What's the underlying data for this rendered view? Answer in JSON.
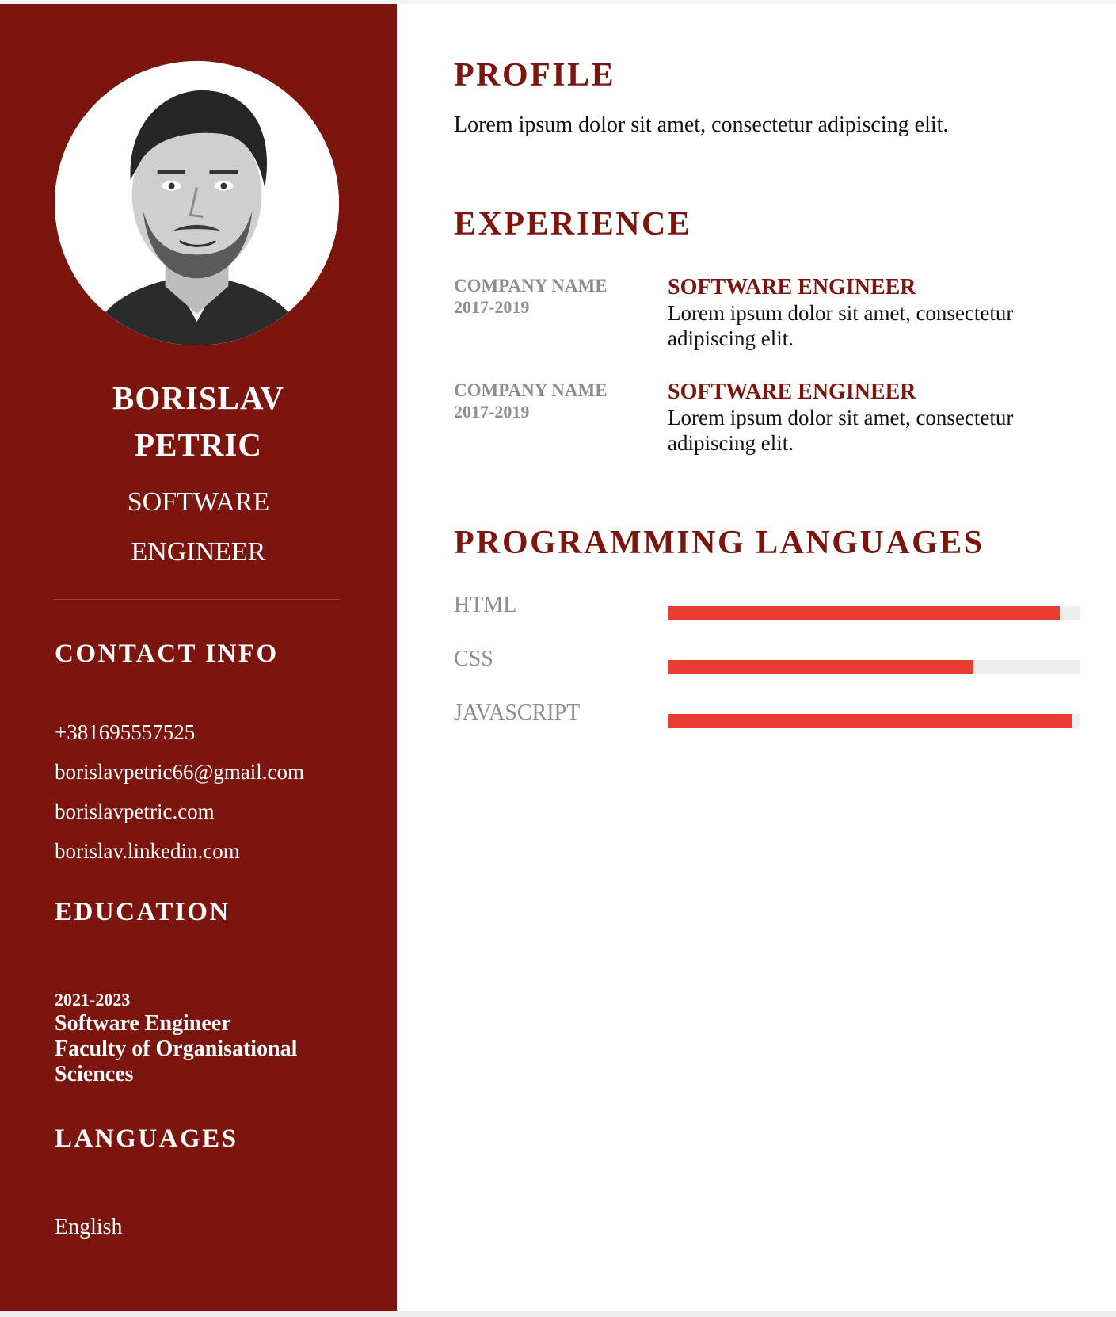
{
  "sidebar": {
    "name": [
      "BORISLAV",
      "PETRIC"
    ],
    "title": [
      "SOFTWARE",
      "ENGINEER"
    ],
    "contact": {
      "heading": "CONTACT INFO",
      "phone": "+381695557525",
      "email": "borislavpetric66@gmail.com",
      "website": "borislavpetric.com",
      "linkedin": "borislav.linkedin.com"
    },
    "education": {
      "heading": "EDUCATION",
      "years": "2021-2023",
      "degree_lines": [
        "Software Engineer",
        "Faculty of Organisational",
        "Sciences"
      ]
    },
    "languages": {
      "heading": "LANGUAGES",
      "items": [
        "English"
      ]
    }
  },
  "main": {
    "profile": {
      "heading": "PROFILE",
      "text": "Lorem ipsum dolor sit amet, consectetur adipiscing elit."
    },
    "experience": {
      "heading": "EXPERIENCE",
      "items": [
        {
          "company": "COMPANY NAME",
          "years": "2017-2019",
          "role": "SOFTWARE ENGINEER",
          "desc_lines": [
            "Lorem ipsum dolor sit amet, consectetur",
            "adipiscing elit."
          ]
        },
        {
          "company": "COMPANY NAME",
          "years": "2017-2019",
          "role": "SOFTWARE ENGINEER",
          "desc_lines": [
            "Lorem ipsum dolor sit amet, consectetur",
            "adipiscing elit."
          ]
        }
      ]
    },
    "programming": {
      "heading": "PROGRAMMING LANGUAGES",
      "skills": [
        {
          "name": "HTML",
          "level": 0.95
        },
        {
          "name": "CSS",
          "level": 0.74
        },
        {
          "name": "JAVASCRIPT",
          "level": 0.98
        }
      ]
    }
  },
  "colors": {
    "sidebar_bg": "#7d150f",
    "accent": "#7d150f",
    "bar_fill": "#e83d30",
    "bar_track": "#eeeeee",
    "muted_text": "#8a8f96"
  }
}
